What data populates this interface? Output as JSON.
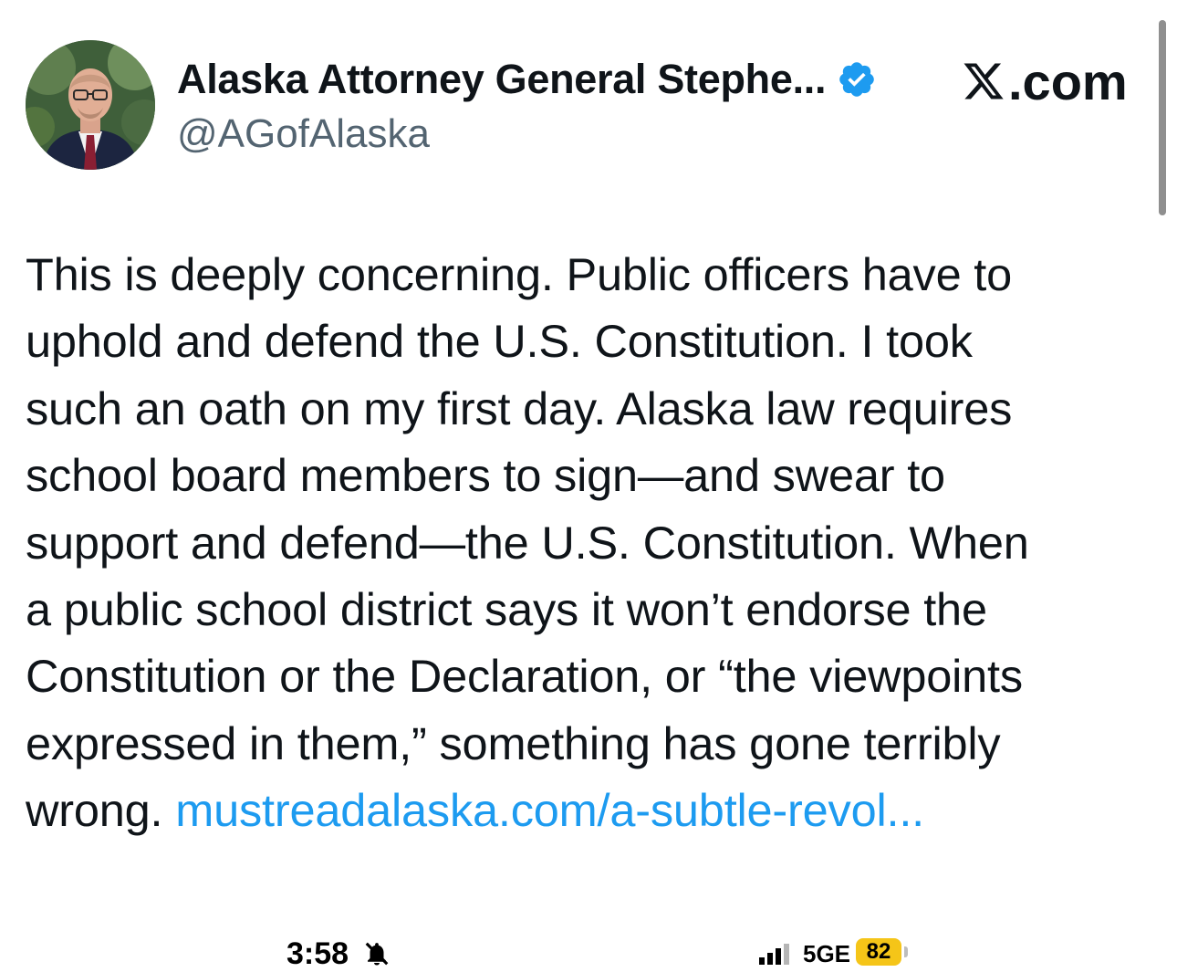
{
  "author": {
    "display_name": "Alaska Attorney General Stephe...",
    "handle": "@AGofAlaska",
    "verified": true,
    "avatar_icon": "profile-photo-man-in-suit"
  },
  "brand": {
    "label": ".com",
    "icon": "x-logo-icon"
  },
  "tweet": {
    "lines": [
      "This is deeply concerning. Public officers have to",
      "uphold and defend the U.S. Constitution. I took",
      "such an oath on my first day. Alaska law requires",
      "school board members to sign—and swear to",
      "support and defend—the U.S. Constitution. When",
      "a public school district says it won’t endorse the",
      "Constitution or the Declaration, or “the viewpoints",
      "expressed in them,” something has gone terribly",
      "wrong. "
    ],
    "link": "mustreadalaska.com/a-subtle-revol..."
  },
  "status_bar": {
    "time": "3:58",
    "network": "5GE",
    "battery": "82",
    "silent_icon": "bell-slash-icon"
  },
  "colors": {
    "link": "#1d9bf0",
    "verified": "#1d9bf0",
    "battery": "#f5c518",
    "handle": "#536471"
  }
}
